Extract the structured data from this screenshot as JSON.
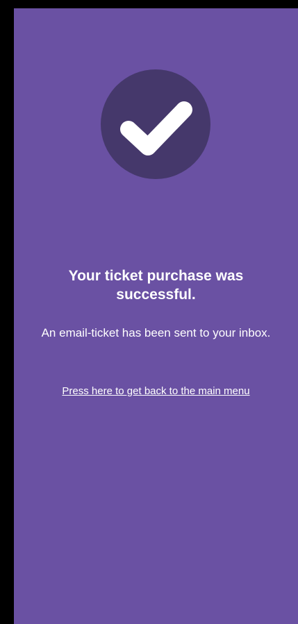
{
  "colors": {
    "background": "#6a51a3",
    "badge": "#45386b",
    "text": "#ffffff",
    "frame": "#000000"
  },
  "success": {
    "icon": "checkmark-icon",
    "title": "Your ticket purchase was successful.",
    "message": "An email-ticket has been sent to your inbox.",
    "back_link_label": "Press here to get back to the main menu"
  }
}
